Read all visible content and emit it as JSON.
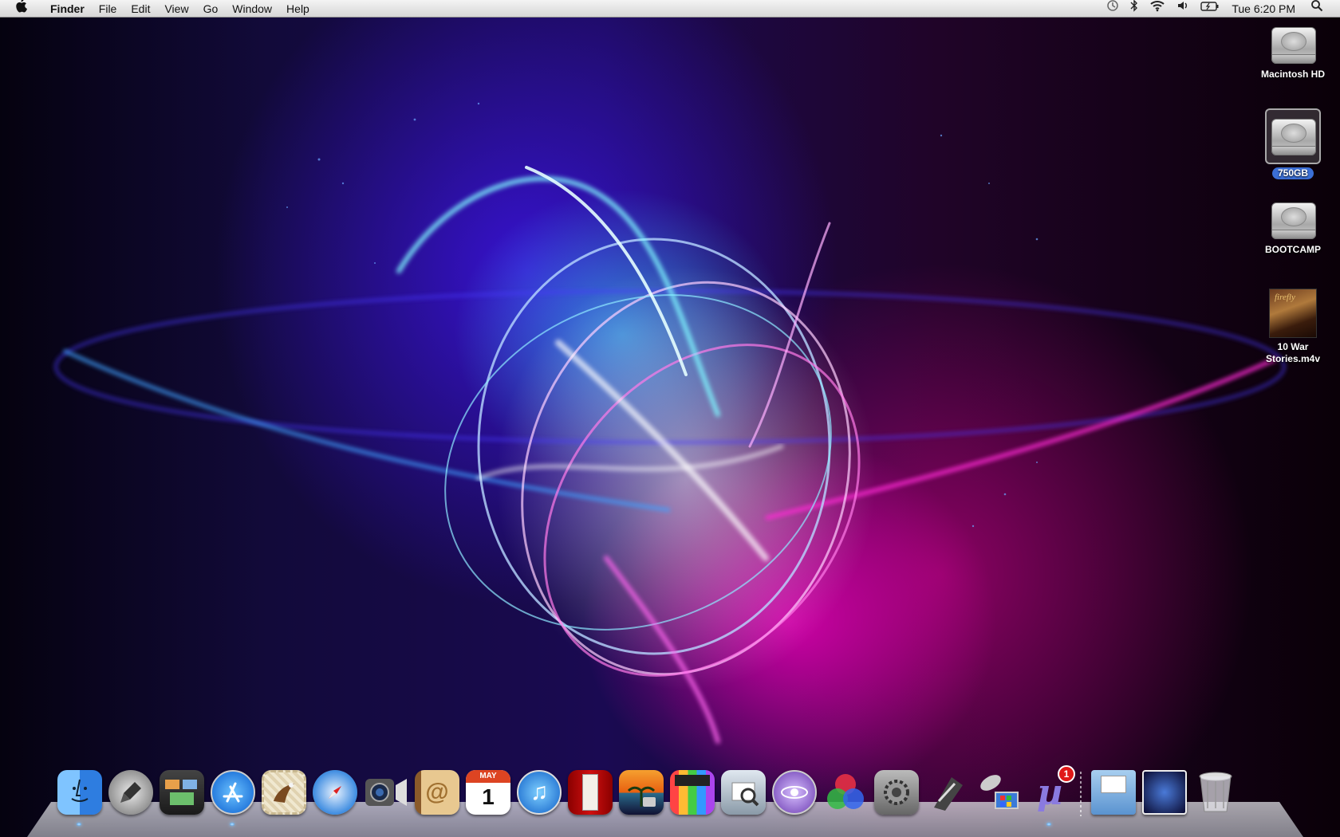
{
  "menubar": {
    "app_name": "Finder",
    "menus": [
      "File",
      "Edit",
      "View",
      "Go",
      "Window",
      "Help"
    ],
    "clock": "Tue 6:20 PM"
  },
  "desktop": {
    "icons": [
      {
        "label": "Macintosh HD",
        "kind": "hard-drive",
        "selected": false
      },
      {
        "label": "750GB",
        "kind": "hard-drive",
        "selected": true
      },
      {
        "label": "BOOTCAMP",
        "kind": "hard-drive",
        "selected": false
      },
      {
        "label": "10 War Stories.m4v",
        "line1": "10 War",
        "line2": "Stories.m4v",
        "kind": "video-file",
        "thumb_text": "firefly"
      }
    ]
  },
  "dock": {
    "items": [
      {
        "name": "Finder",
        "icon": "finder-icon",
        "running": true
      },
      {
        "name": "Launchpad",
        "icon": "launchpad-icon",
        "running": false
      },
      {
        "name": "Mission Control",
        "icon": "mission-control-icon",
        "running": false
      },
      {
        "name": "App Store",
        "icon": "app-store-icon",
        "running": true
      },
      {
        "name": "Mail",
        "icon": "mail-icon",
        "running": false
      },
      {
        "name": "Safari",
        "icon": "safari-icon",
        "running": false
      },
      {
        "name": "FaceTime",
        "icon": "facetime-icon",
        "running": false
      },
      {
        "name": "Address Book",
        "icon": "address-book-icon",
        "running": false
      },
      {
        "name": "iCal",
        "icon": "ical-icon",
        "calendar_month": "MAY",
        "calendar_day": "1",
        "running": false
      },
      {
        "name": "iTunes",
        "icon": "itunes-icon",
        "running": false
      },
      {
        "name": "Photo Booth",
        "icon": "photo-booth-icon",
        "running": false
      },
      {
        "name": "iPhoto",
        "icon": "iphoto-icon",
        "running": false
      },
      {
        "name": "Final Cut Pro",
        "icon": "final-cut-pro-icon",
        "running": false
      },
      {
        "name": "Preview",
        "icon": "preview-icon",
        "running": false
      },
      {
        "name": "Motion",
        "icon": "motion-icon",
        "running": false
      },
      {
        "name": "Color",
        "icon": "color-icon",
        "running": false
      },
      {
        "name": "System Preferences",
        "icon": "system-preferences-icon",
        "running": false
      },
      {
        "name": "Compressor",
        "icon": "compressor-icon",
        "running": false
      },
      {
        "name": "Remote Desktop",
        "icon": "remote-desktop-icon",
        "running": false
      },
      {
        "name": "uTorrent",
        "icon": "utorrent-icon",
        "badge": "1",
        "running": true
      }
    ],
    "right_items": [
      {
        "name": "Documents",
        "icon": "documents-folder-icon"
      },
      {
        "name": "Downloads",
        "icon": "downloads-stack-icon"
      },
      {
        "name": "Trash",
        "icon": "trash-icon"
      }
    ]
  },
  "colors": {
    "selection_blue": "#3b6fd6",
    "badge_red": "#e01818"
  }
}
